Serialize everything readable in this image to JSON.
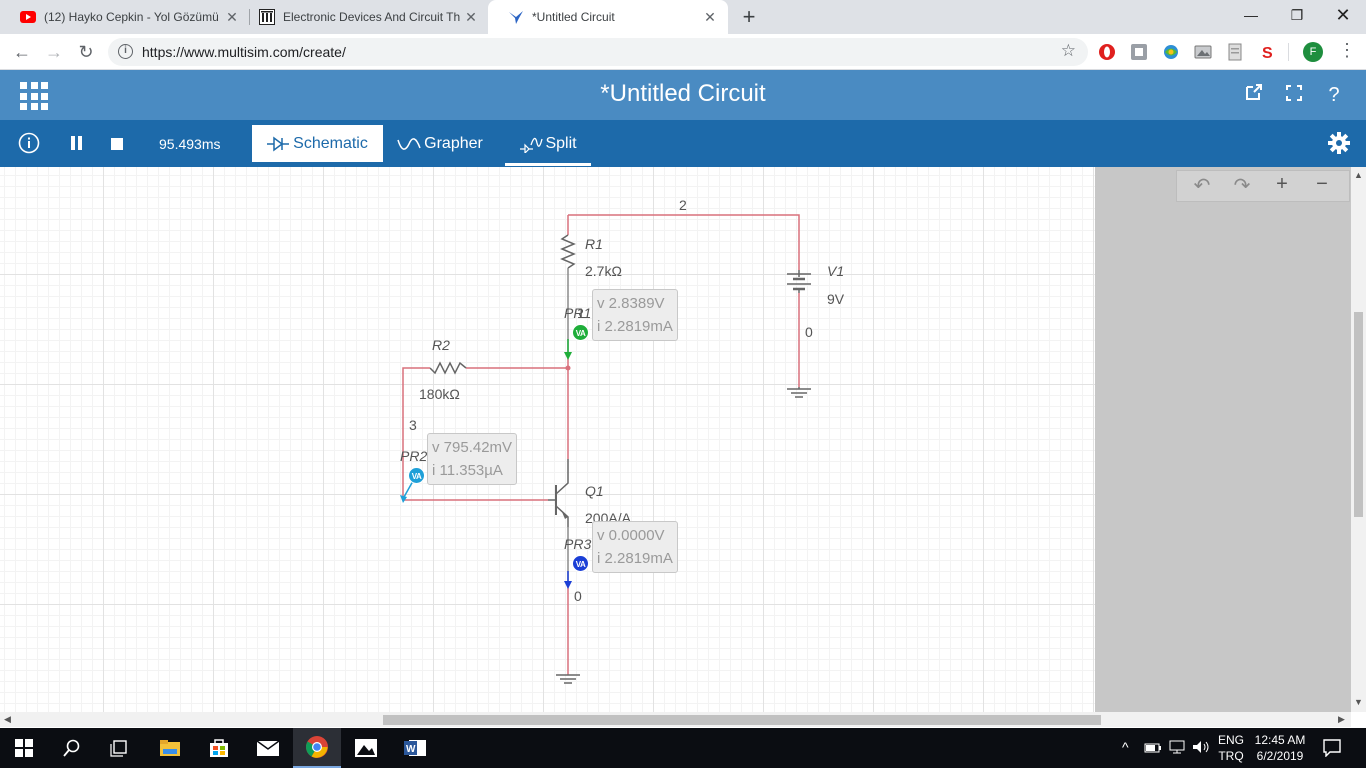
{
  "browser": {
    "tabs": [
      {
        "title": "(12) Hayko Cepkin - Yol Gözümü",
        "icon": "youtube-icon"
      },
      {
        "title": "Electronic Devices And Circuit Th",
        "icon": "library-icon"
      },
      {
        "title": "*Untitled Circuit",
        "icon": "multisim-icon",
        "active": true
      }
    ],
    "url": "https://www.multisim.com/create/",
    "profile_initial": "F"
  },
  "app": {
    "title": "*Untitled Circuit",
    "timer": "95.493ms",
    "modes": [
      "Schematic",
      "Grapher",
      "Split"
    ],
    "active_mode": "Schematic"
  },
  "schematic": {
    "components": {
      "r1": {
        "name": "R1",
        "value": "2.7kΩ"
      },
      "r2": {
        "name": "R2",
        "value": "180kΩ"
      },
      "v1": {
        "name": "V1",
        "value": "9V"
      },
      "q1": {
        "name": "Q1",
        "value": "200A/A"
      }
    },
    "nets": {
      "n2": "2",
      "n3": "3",
      "n0a": "0",
      "n0b": "0",
      "n1": "1"
    },
    "probes": {
      "pr1": {
        "name": "PR1",
        "v": "v 2.8389V",
        "i": "i  2.2819mA",
        "color": "#1fae3a"
      },
      "pr2": {
        "name": "PR2",
        "v": "v 795.42mV",
        "i": "i  11.353µA",
        "color": "#1fa0d8"
      },
      "pr3": {
        "name": "PR3",
        "v": "v 0.0000V",
        "i": "i  2.2819mA",
        "color": "#1b3fd6"
      }
    },
    "probe_badge": "VA",
    "wire_color": "#d9707c"
  },
  "taskbar": {
    "lang_top": "ENG",
    "lang_bottom": "TRQ",
    "time": "12:45 AM",
    "date": "6/2/2019"
  }
}
